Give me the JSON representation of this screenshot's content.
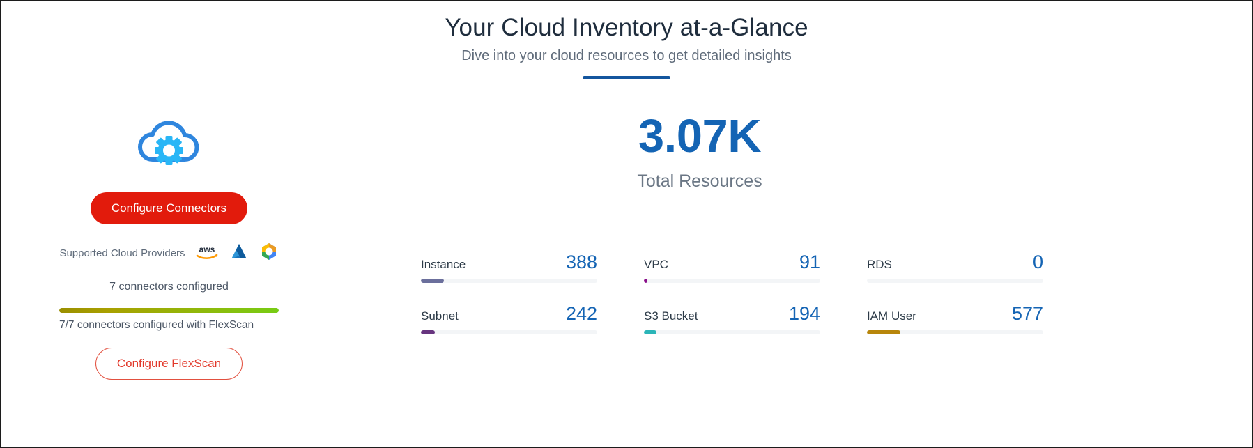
{
  "header": {
    "title": "Your Cloud Inventory at-a-Glance",
    "subtitle": "Dive into your cloud resources to get detailed insights",
    "accent_color": "#14569e"
  },
  "left_panel": {
    "cloud_icon_name": "cloud-gear-icon",
    "configure_connectors_label": "Configure Connectors",
    "configure_connectors_color": "#e21b0c",
    "providers_label": "Supported Cloud Providers",
    "providers": [
      {
        "name": "aws-logo",
        "label": "aws"
      },
      {
        "name": "azure-logo",
        "label": "Azure"
      },
      {
        "name": "gcp-logo",
        "label": "Google Cloud"
      }
    ],
    "connectors_configured_text": "7 connectors configured",
    "progress_percent": 100,
    "flexscan_text": "7/7 connectors configured with FlexScan",
    "configure_flexscan_label": "Configure FlexScan",
    "configure_flexscan_color": "#e2392b"
  },
  "summary": {
    "total_value": "3.07K",
    "total_label": "Total Resources",
    "total_color": "#1464b4"
  },
  "metrics": [
    {
      "label": "Instance",
      "value": "388",
      "bar_percent": 13,
      "bar_color": "#6b6f9c"
    },
    {
      "label": "VPC",
      "value": "91",
      "bar_percent": 2,
      "bar_color": "#8a0f8a"
    },
    {
      "label": "RDS",
      "value": "0",
      "bar_percent": 0,
      "bar_color": "#c9cdd3"
    },
    {
      "label": "Subnet",
      "value": "242",
      "bar_percent": 8,
      "bar_color": "#67357f"
    },
    {
      "label": "S3 Bucket",
      "value": "194",
      "bar_percent": 7,
      "bar_color": "#2bb5b8"
    },
    {
      "label": "IAM User",
      "value": "577",
      "bar_percent": 19,
      "bar_color": "#b8860b"
    }
  ]
}
